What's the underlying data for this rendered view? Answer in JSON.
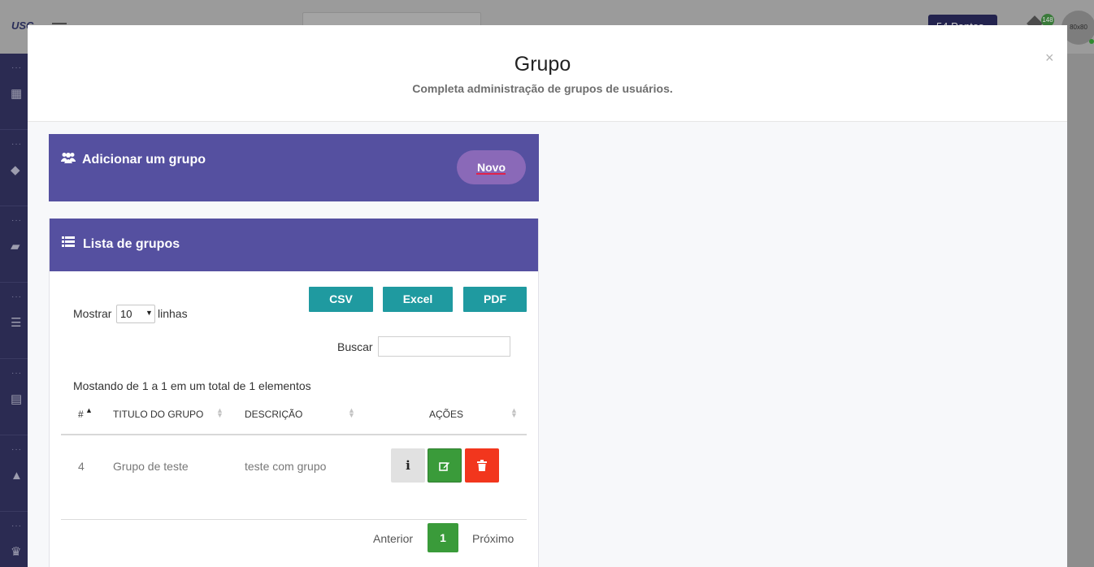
{
  "background": {
    "logo": "USC",
    "points_label": "54 Pontos",
    "notification_count": "148",
    "avatar_label": "80x80",
    "sidebar_icons": [
      "dashboard-icon",
      "graduation-cap-icon",
      "book-icon",
      "list-icon",
      "calendar-icon",
      "bell-icon",
      "trophy-icon"
    ]
  },
  "modal": {
    "title": "Grupo",
    "subtitle": "Completa administração de grupos de usuários.",
    "close_label": "×"
  },
  "add_card": {
    "title": "Adicionar um grupo",
    "icon": "users-icon",
    "new_button": "Novo"
  },
  "list_card": {
    "title": "Lista de grupos",
    "icon": "list-icon",
    "export_buttons": [
      "CSV",
      "Excel",
      "PDF"
    ],
    "length_prefix": "Mostrar",
    "length_value": "10",
    "length_suffix": "linhas",
    "search_label": "Buscar",
    "search_value": "",
    "info": "Mostando de 1 a 1 em um total de 1 elementos",
    "columns": [
      "#",
      "TITULO DO GRUPO",
      "DESCRIÇÃO",
      "AÇÕES"
    ],
    "rows": [
      {
        "id": "4",
        "title": "Grupo de teste",
        "description": "teste com grupo"
      }
    ],
    "pagination": {
      "previous": "Anterior",
      "current": "1",
      "next": "Próximo"
    }
  },
  "colors": {
    "card_header": "#5550a0",
    "export_button": "#1f9aa0",
    "edit_button": "#3a9b3a",
    "delete_button": "#f2361d",
    "novo_button": "#8a69b8"
  }
}
